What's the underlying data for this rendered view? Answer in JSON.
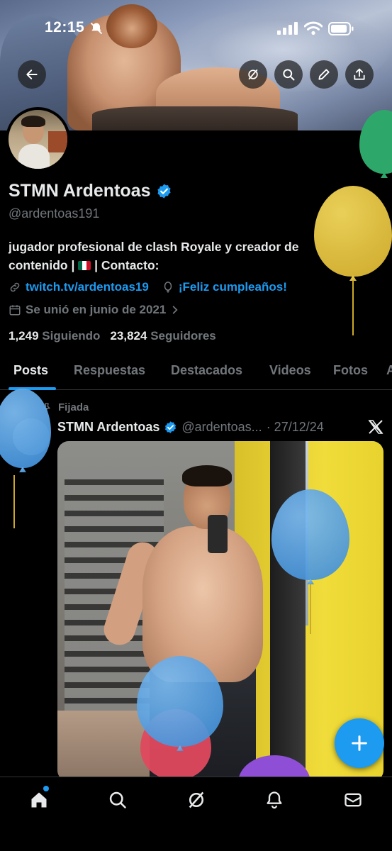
{
  "status_bar": {
    "time": "12:15"
  },
  "profile": {
    "name": "STMN Ardentoas",
    "handle": "@ardentoas191",
    "bio_line1": "jugador profesional de clash Royale y creador de",
    "bio_line2_pre": "contenido | ",
    "bio_line2_post": " | Contacto:",
    "link": "twitch.tv/ardentoas19",
    "birthday": "¡Feliz cumpleaños!",
    "joined": "Se unió en junio de 2021",
    "following_count": "1,249",
    "following_label": "Siguiendo",
    "followers_count": "23,824",
    "followers_label": "Seguidores"
  },
  "tabs": [
    "Posts",
    "Respuestas",
    "Destacados",
    "Videos",
    "Fotos",
    "A"
  ],
  "post": {
    "pinned_label": "Fijada",
    "author_name": "STMN Ardentoas",
    "author_handle": "@ardentoas...",
    "date": "· 27/12/24"
  },
  "colors": {
    "accent": "#1d9bf0",
    "muted": "#71767b",
    "text": "#e7e9ea",
    "balloon_yellow": "#d9b72e",
    "balloon_green": "#2ea86a",
    "balloon_blue": "#4a9be0",
    "balloon_red": "#e0495e",
    "balloon_purple": "#8e4fd6"
  },
  "icons": {
    "back": "arrow-left-icon",
    "grok": "grok-icon",
    "search": "search-icon",
    "edit": "pencil-icon",
    "share": "share-icon",
    "verified": "verified-badge-icon",
    "link": "link-icon",
    "balloon": "balloon-icon",
    "calendar": "calendar-icon",
    "chevron": "chevron-right-icon",
    "pin": "pin-icon",
    "x_logo": "x-logo-icon",
    "compose": "plus-icon",
    "nav": [
      "home-icon",
      "search-icon",
      "grok-icon",
      "bell-icon",
      "mail-icon"
    ]
  }
}
